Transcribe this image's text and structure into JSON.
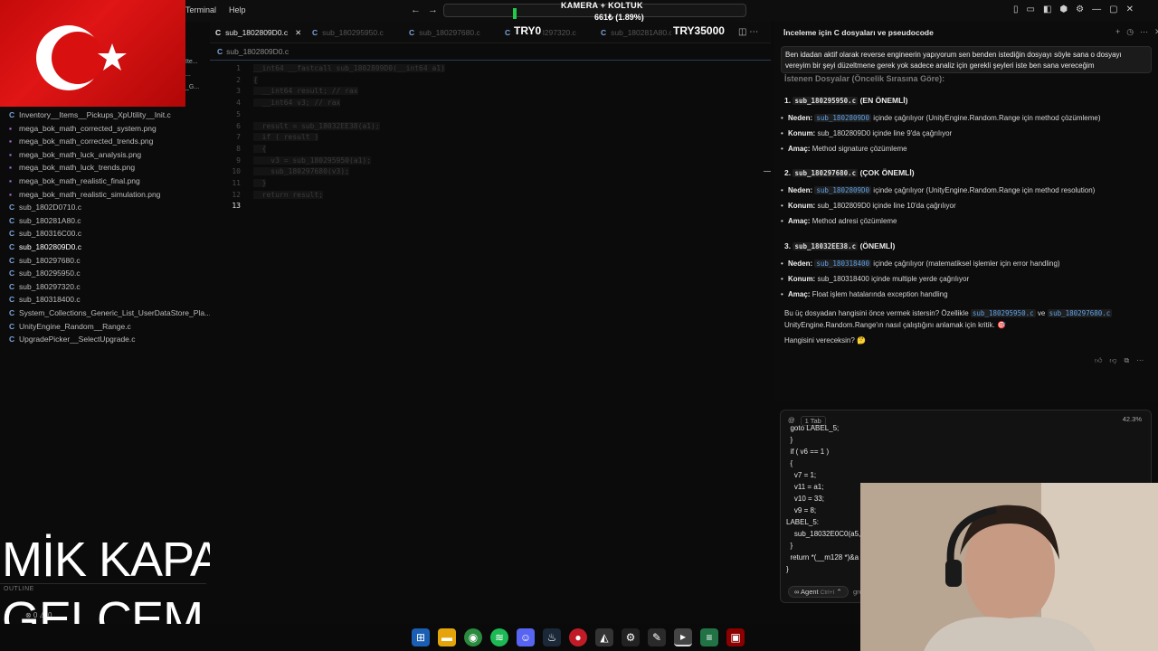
{
  "menu": {
    "terminal": "Terminal",
    "help": "Help"
  },
  "overlay": {
    "camera_title": "KAMERA + KOLTUK",
    "camera_count": "661₺ (1.89%)",
    "try0": "TRY0",
    "try35000": "TRY35000",
    "mic_line1": "MİK KAPALI",
    "mic_line2": "GELCEM"
  },
  "tabs": [
    {
      "label": "sub_1802809D0.c",
      "active": true
    },
    {
      "label": "sub_180295950.c",
      "active": false
    },
    {
      "label": "sub_180297680.c",
      "active": false
    },
    {
      "label": "sub_180297320.c",
      "active": false
    },
    {
      "label": "sub_180281A80.c",
      "active": false
    }
  ],
  "breadcrumb": "sub_1802809D0.c",
  "explorer": {
    "files": [
      {
        "name": "Inventory__Items__Pickups_XpUtility__Init.c",
        "type": "c"
      },
      {
        "name": "mega_bok_math_corrected_system.png",
        "type": "png"
      },
      {
        "name": "mega_bok_math_corrected_trends.png",
        "type": "png"
      },
      {
        "name": "mega_bok_math_luck_analysis.png",
        "type": "png"
      },
      {
        "name": "mega_bok_math_luck_trends.png",
        "type": "png"
      },
      {
        "name": "mega_bok_math_realistic_final.png",
        "type": "png"
      },
      {
        "name": "mega_bok_math_realistic_simulation.png",
        "type": "png"
      },
      {
        "name": "sub_1802D0710.c",
        "type": "c"
      },
      {
        "name": "sub_180281A80.c",
        "type": "c"
      },
      {
        "name": "sub_180316C00.c",
        "type": "c"
      },
      {
        "name": "sub_1802809D0.c",
        "type": "c",
        "active": true
      },
      {
        "name": "sub_180297680.c",
        "type": "c"
      },
      {
        "name": "sub_180295950.c",
        "type": "c"
      },
      {
        "name": "sub_180297320.c",
        "type": "c"
      },
      {
        "name": "sub_180318400.c",
        "type": "c"
      },
      {
        "name": "System_Collections_Generic_List_UserDataStore_Pla...",
        "type": "c"
      },
      {
        "name": "UnityEngine_Random__Range.c",
        "type": "c"
      },
      {
        "name": "UpgradePicker__SelectUpgrade.c",
        "type": "c"
      }
    ],
    "side_clips": [
      "Ite...",
      "...",
      "_G..."
    ],
    "outline": "OUTLINE",
    "status": "⊗ 0 ⚠ 0"
  },
  "editor": {
    "line_numbers": [
      "1",
      "2",
      "3",
      "4",
      "5",
      "6",
      "7",
      "8",
      "9",
      "10",
      "11",
      "12",
      "13"
    ],
    "active_line": "13",
    "lines": [
      "__int64 __fastcall sub_1802809D0(__int64 a1)",
      "{",
      "  __int64 result; // rax",
      "  __int64 v3; // rax",
      "",
      "  result = sub_18032EE38(a1);",
      "  if ( result )",
      "  {",
      "    v3 = sub_180295950(a1);",
      "    sub_180297680(v3);",
      "  }",
      "  return result;",
      ""
    ]
  },
  "chat": {
    "title": "İnceleme için C dosyaları ve pseudocode",
    "user_message": "Ben idadan aktif olarak reverse engineerin yapıyorum sen benden istediğin dosyayı söyle sana o dosyayı vereyim bir şeyi düzeltmene gerek yok sadece analiz için gerekli şeyleri iste ben sana vereceğim",
    "requested_header": "İstenen Dosyalar (Öncelik Sırasına Göre):",
    "sections": [
      {
        "num": "1.",
        "file": "sub_180295950.c",
        "tag": "(EN ÖNEMLİ)",
        "neden_label": "Neden:",
        "neden_ref": "sub_1802809D0",
        "neden_text": "içinde çağrılıyor (UnityEngine.Random.Range için method çözümleme)",
        "konum_label": "Konum:",
        "konum_text": "sub_1802809D0 içinde line 9'da çağrılıyor",
        "amac_label": "Amaç:",
        "amac_text": "Method signature çözümleme"
      },
      {
        "num": "2.",
        "file": "sub_180297680.c",
        "tag": "(ÇOK ÖNEMLİ)",
        "neden_label": "Neden:",
        "neden_ref": "sub_1802809D0",
        "neden_text": "içinde çağrılıyor (UnityEngine.Random.Range için method resolution)",
        "konum_label": "Konum:",
        "konum_text": "sub_1802809D0 içinde line 10'da çağrılıyor",
        "amac_label": "Amaç:",
        "amac_text": "Method adresi çözümleme"
      },
      {
        "num": "3.",
        "file": "sub_18032EE38.c",
        "tag": "(ÖNEMLİ)",
        "neden_label": "Neden:",
        "neden_ref": "sub_180318400",
        "neden_text": "içinde çağrılıyor (matematiksel işlemler için error handling)",
        "konum_label": "Konum:",
        "konum_text": "sub_180318400 içinde multiple yerde çağrılıyor",
        "amac_label": "Amaç:",
        "amac_text": "Float işlem hatalarında exception handling"
      }
    ],
    "closing_p1_a": "Bu üç dosyadan hangisini önce vermek istersin? Özellikle",
    "closing_ref1": "sub_180295950.c",
    "closing_ve": "ve",
    "closing_ref2": "sub_180297680.c",
    "closing_p1_b": "UnityEngine.Random.Range'ın nasıl çalıştığını anlamak için kritik. 🎯",
    "closing_p2": "Hangisini vereceksin? 🤔"
  },
  "input": {
    "tab_pill": "1 Tab",
    "percent": "42.3%",
    "code_lines": [
      "  goto LABEL_5;",
      "  }",
      "  if ( v6 == 1 )",
      "  {",
      "    v7 = 1;",
      "    v11 = a1;",
      "    v10 = 33;",
      "    v9 = 8;",
      "LABEL_5:",
      "    sub_18032E0C0(a5,",
      "  }",
      "  return *(__m128 *)&a",
      "}"
    ],
    "agent_label": "∞ Agent",
    "agent_kbd": "Ctrl+I",
    "model": "gro"
  }
}
